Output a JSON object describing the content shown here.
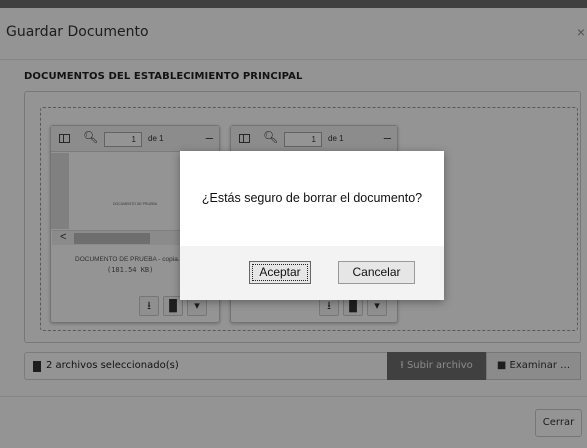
{
  "modal": {
    "title": "Guardar Documento",
    "close_glyph": "×",
    "section_title": "DOCUMENTOS DEL ESTABLECIMIENTO PRINCIPAL"
  },
  "files": [
    {
      "page_input": "1",
      "page_of": "de 1",
      "preview_text": "DOCUMENTO DE PRUEBA",
      "name": "DOCUMENTO DE PRUEBA - copia.pdf",
      "size": "(181.54 KB)"
    },
    {
      "page_input": "1",
      "page_of": "de 1"
    }
  ],
  "selection": {
    "text": "2 archivos seleccionado(s)",
    "upload_label": "Subir archivo",
    "browse_label": "Examinar …"
  },
  "footer": {
    "close_label": "Cerrar"
  },
  "confirm": {
    "message": "¿Estás seguro de borrar el documento?",
    "accept_label": "Aceptar",
    "cancel_label": "Cancelar"
  },
  "icons": {
    "sidebar": "sidebar-toggle-icon",
    "search": "search-icon",
    "zoom_out": "minus-icon",
    "download": "download-icon",
    "delete": "trash-icon",
    "file": "file-icon",
    "upload": "upload-icon",
    "folder": "folder-open-icon"
  }
}
